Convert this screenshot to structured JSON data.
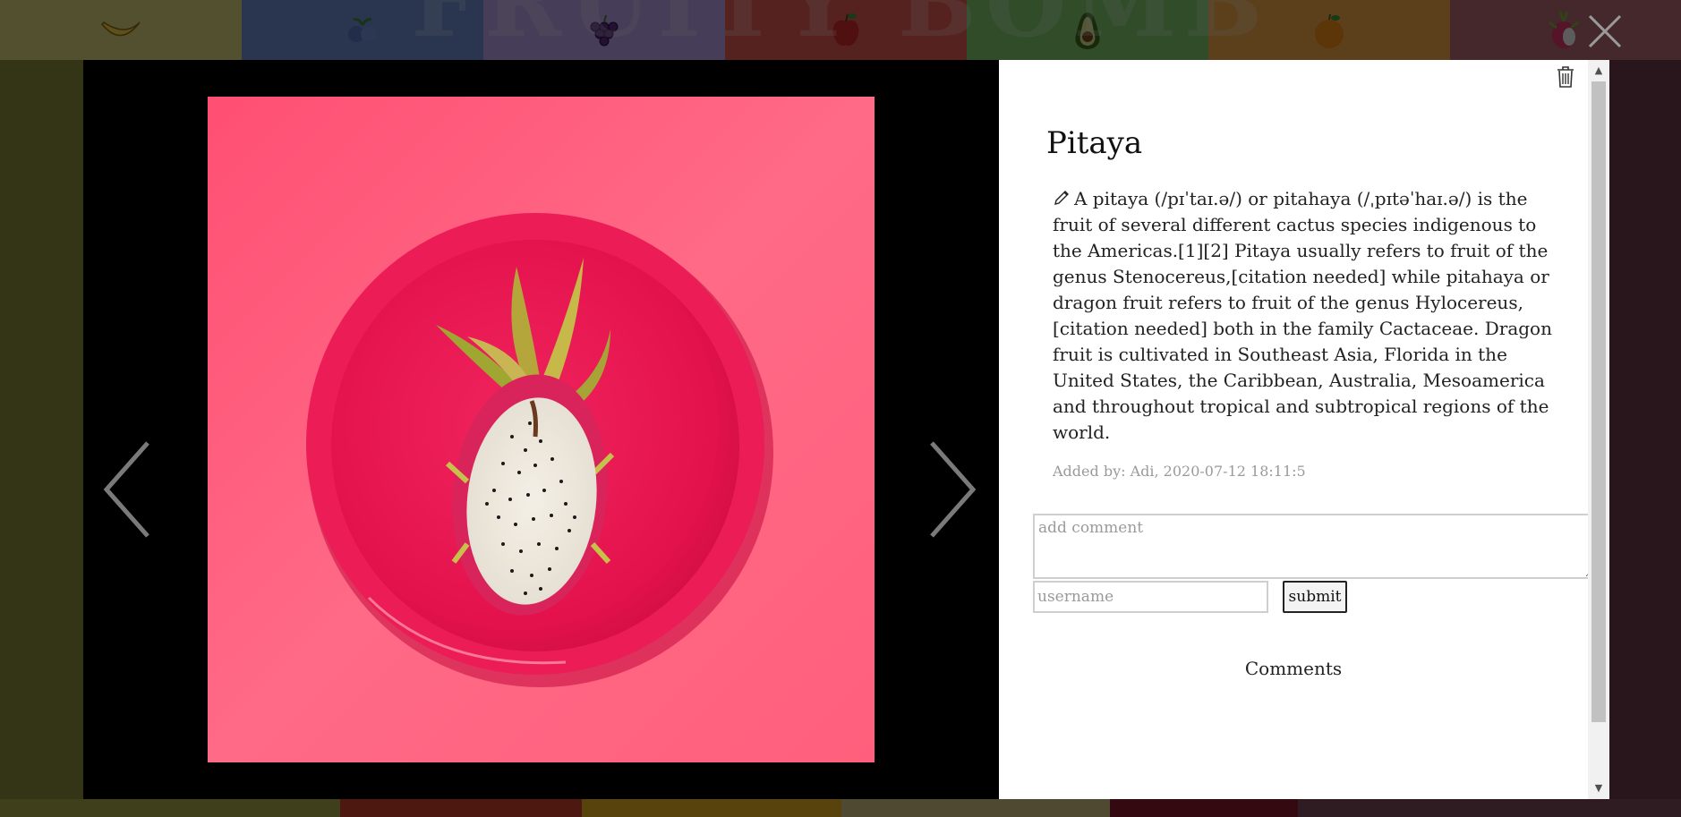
{
  "background": {
    "site_title": "FRUITY BOMB",
    "nav_icons": [
      "banana-icon",
      "blueberry-icon",
      "grapes-icon",
      "apple-icon",
      "avocado-icon",
      "orange-icon",
      "dragonfruit-icon"
    ],
    "nav_colors": [
      "#d8d37a",
      "#6e8fcf",
      "#b9a0e6",
      "#e05a52",
      "#7fc96c",
      "#f1a94a",
      "#b56b72"
    ]
  },
  "modal": {
    "close_icon": "close-icon",
    "prev_icon": "chevron-left-icon",
    "next_icon": "chevron-right-icon",
    "image": {
      "description": "Dragon fruit half on pink plate",
      "background_color": "#ff5c7c",
      "plate_color": "#ee1f5a"
    },
    "delete_icon": "trash-icon",
    "title": "Pitaya",
    "edit_icon": "pencil-icon",
    "description": "A pitaya (/pɪˈtaɪ.ə/) or pitahaya (/ˌpɪtəˈhaɪ.ə/) is the fruit of several different cactus species indigenous to the Americas.[1][2] Pitaya usually refers to fruit of the genus Stenocereus,[citation needed] while pitahaya or dragon fruit refers to fruit of the genus Hylocereus,[citation needed] both in the family Cactaceae. Dragon fruit is cultivated in Southeast Asia, Florida in the United States, the Caribbean, Australia, Mesoamerica and throughout tropical and subtropical regions of the world.",
    "added_by": "Added by: Adi, 2020-07-12 18:11:5",
    "comment_placeholder": "add comment",
    "username_placeholder": "username",
    "submit_label": "submit",
    "comments_heading": "Comments"
  }
}
